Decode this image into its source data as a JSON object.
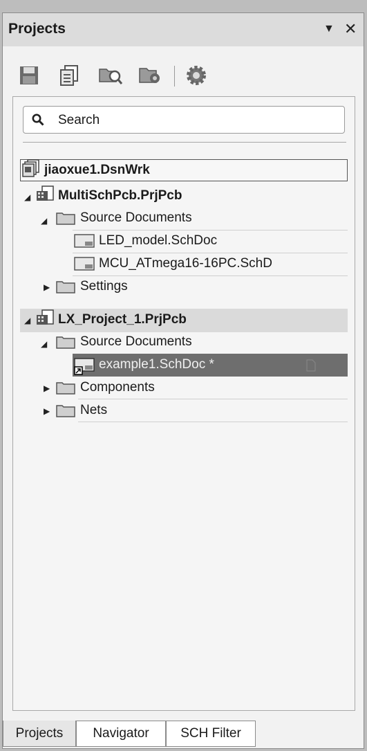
{
  "panel": {
    "title": "Projects",
    "pin_glyph": "▼",
    "close_glyph": "✕"
  },
  "toolbar": {
    "icons": [
      "save-icon",
      "copy-document-icon",
      "find-document-icon",
      "compile-icon",
      "settings-gear-icon"
    ]
  },
  "search": {
    "placeholder": "Search"
  },
  "tree": {
    "workspace": "jiaoxue1.DsnWrk",
    "projects": [
      {
        "name": "MultiSchPcb.PrjPcb",
        "source_label": "Source Documents",
        "documents": [
          "LED_model.SchDoc",
          "MCU_ATmega16-16PC.SchD"
        ],
        "settings_label": "Settings"
      },
      {
        "name": "LX_Project_1.PrjPcb",
        "source_label": "Source Documents",
        "documents": [
          "example1.SchDoc *"
        ],
        "components_label": "Components",
        "nets_label": "Nets"
      }
    ]
  },
  "tabs": [
    "Projects",
    "Navigator",
    "SCH Filter"
  ],
  "colors": {
    "selected_row": "#6e6e6e",
    "hover_row": "#dadada",
    "titlebar": "#dcdcdc"
  }
}
